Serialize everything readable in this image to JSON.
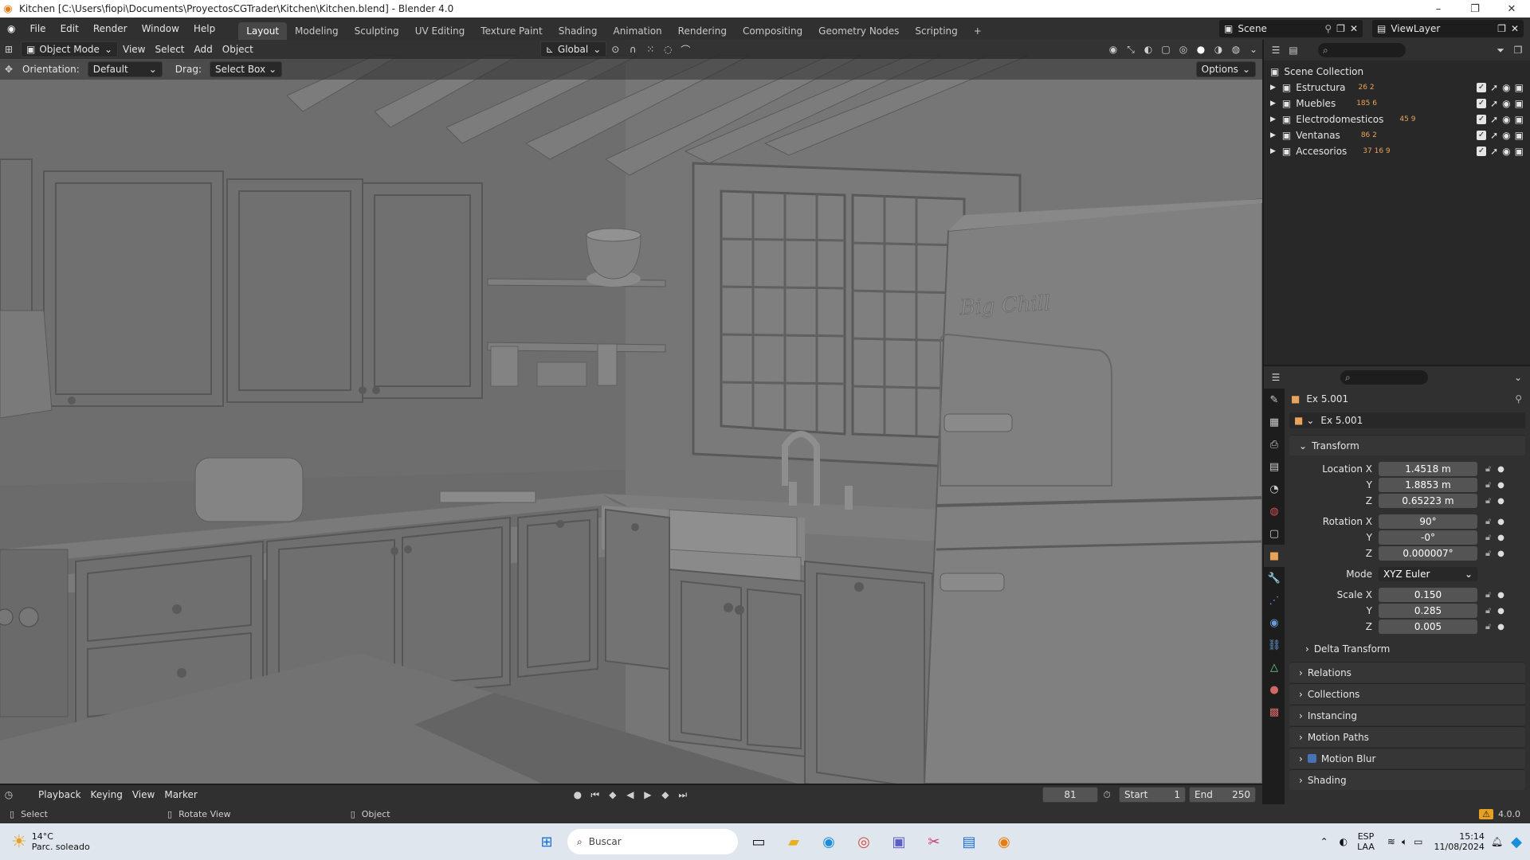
{
  "window": {
    "title": "Kitchen [C:\\Users\\fiopi\\Documents\\ProyectosCGTrader\\Kitchen\\Kitchen.blend] - Blender 4.0",
    "minimize": "–",
    "maximize": "❐",
    "close": "✕"
  },
  "menu": [
    "File",
    "Edit",
    "Render",
    "Window",
    "Help"
  ],
  "workspaces": [
    "Layout",
    "Modeling",
    "Sculpting",
    "UV Editing",
    "Texture Paint",
    "Shading",
    "Animation",
    "Rendering",
    "Compositing",
    "Geometry Nodes",
    "Scripting",
    "+"
  ],
  "scene": {
    "name": "Scene",
    "view_layer": "ViewLayer"
  },
  "viewport": {
    "mode": "Object Mode",
    "menus": [
      "View",
      "Select",
      "Add",
      "Object"
    ],
    "transform_orientation": "Global",
    "orientation_label": "Orientation:",
    "orientation_value": "Default",
    "drag_label": "Drag:",
    "drag_value": "Select Box",
    "options": "Options",
    "fridge_brand": "Big Chill"
  },
  "outliner": {
    "root": "Scene Collection",
    "collections": [
      {
        "name": "Estructura",
        "counts": "26 2"
      },
      {
        "name": "Muebles",
        "counts": "185 6"
      },
      {
        "name": "Electrodomesticos",
        "counts": "45 9"
      },
      {
        "name": "Ventanas",
        "counts": "86 2"
      },
      {
        "name": "Accesorios",
        "counts": "37 16 9"
      }
    ]
  },
  "properties": {
    "object_name": "Ex 5.001",
    "data_name": "Ex 5.001",
    "transform_header": "Transform",
    "location_label": "Location X",
    "location": [
      "1.4518 m",
      "1.8853 m",
      "0.65223 m"
    ],
    "rotation_label": "Rotation X",
    "rotation": [
      "90°",
      "-0°",
      "0.000007°"
    ],
    "mode_label": "Mode",
    "mode": "XYZ Euler",
    "scale_label": "Scale X",
    "scale": [
      "0.150",
      "0.285",
      "0.005"
    ],
    "axis_y": "Y",
    "axis_z": "Z",
    "delta": "Delta Transform",
    "panels": [
      "Relations",
      "Collections",
      "Instancing",
      "Motion Paths",
      "Motion Blur",
      "Shading"
    ]
  },
  "timeline": {
    "menus": [
      "Playback",
      "Keying",
      "View",
      "Marker"
    ],
    "current_frame": "81",
    "start_label": "Start",
    "start": "1",
    "end_label": "End",
    "end": "250"
  },
  "status": {
    "select": "Select",
    "rotate": "Rotate View",
    "object": "Object",
    "version": "4.0.0"
  },
  "taskbar": {
    "weather_temp": "14°C",
    "weather_desc": "Parc. soleado",
    "search_placeholder": "Buscar",
    "lang1": "ESP",
    "lang2": "LAA",
    "time": "15:14",
    "date": "11/08/2024"
  },
  "colors": {
    "accent": "#4772b3",
    "blender_orange": "#e87d0d"
  }
}
